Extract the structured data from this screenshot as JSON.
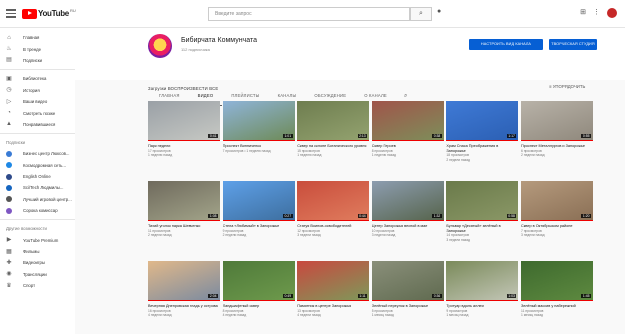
{
  "topbar": {
    "logo_text": "YouTube",
    "logo_region": "RU",
    "search_placeholder": "Введите запрос",
    "search_icon": "search-icon",
    "mic_icon": "microphone-icon"
  },
  "sidebar": {
    "main": [
      "Главная",
      "В тренде",
      "Подписки"
    ],
    "library": [
      "Библиотека",
      "История",
      "Ваши видео",
      "Смотреть позже",
      "Понравившиеся"
    ],
    "subs_heading": "Подписки",
    "subs": [
      "Бизнес центр Люксов...",
      "Космодромная сеть...",
      "English Online",
      "Sci/Tech Людмилы...",
      "Лучший игровой центр...",
      "Сорока комиссар"
    ],
    "more_heading": "Другие возможности",
    "more": [
      "YouTube Premium",
      "Фильмы",
      "Видеоигры",
      "Трансляции",
      "Спорт"
    ]
  },
  "channel": {
    "name": "Бибирчата Коммунчата",
    "subscribers": "112 подписчика",
    "customize_button": "НАСТРОИТЬ ВИД КАНАЛА",
    "manage_button": "ТВОРЧЕСКАЯ СТУДИЯ",
    "tabs": [
      "ГЛАВНАЯ",
      "ВИДЕО",
      "ПЛЕЙЛИСТЫ",
      "КАНАЛЫ",
      "ОБСУЖДЕНИЕ",
      "О КАНАЛЕ"
    ],
    "active_tab": "ВИДЕО"
  },
  "uploads": {
    "title": "Загрузки   ВОСПРОИЗВЕСТИ ВСЕ",
    "sort_label": "УПОРЯДОЧИТЬ",
    "videos": [
      {
        "title": "Парк недели",
        "views": "17 просмотров",
        "age": "1 неделю назад",
        "duration": "0:41",
        "c1": "#9aa0a6",
        "c2": "#c7c9c4"
      },
      {
        "title": "Проспект Винниченко",
        "views": "7 просмотров • 1 неделю назад",
        "age": "",
        "duration": "1:01",
        "c1": "#8fb4d9",
        "c2": "#6d8a55"
      },
      {
        "title": "Сквер на склоне Ботанического уровня",
        "views": "15 просмотров",
        "age": "1 неделю назад",
        "duration": "2:13",
        "c1": "#6e7d4f",
        "c2": "#94a370"
      },
      {
        "title": "Сквер Героев",
        "views": "8 просмотров",
        "age": "1 неделю назад",
        "duration": "0:38",
        "c1": "#a0544a",
        "c2": "#7d8f5a"
      },
      {
        "title": "Храм Спаса Преображения в Запорожье",
        "views": "18 просмотров",
        "age": "2 недели назад",
        "duration": "1:17",
        "c1": "#3f7ad6",
        "c2": "#2b5fb3"
      },
      {
        "title": "Проспект Металлургов и Запорожье",
        "views": "6 просмотров",
        "age": "2 недели назад",
        "duration": "0:55",
        "c1": "#b8b2a8",
        "c2": "#8f887c"
      },
      {
        "title": "Тихий уголок парка Шевченко",
        "views": "11 просмотров",
        "age": "2 недели назад",
        "duration": "1:08",
        "c1": "#6f6a5d",
        "c2": "#a3a58a"
      },
      {
        "title": "Стела «Любимый» в Запорожье",
        "views": "9 просмотров",
        "age": "2 недели назад",
        "duration": "0:27",
        "c1": "#5ea0e8",
        "c2": "#3d6e9e"
      },
      {
        "title": "Статуя Воинов-освободителей",
        "views": "12 просмотров",
        "age": "3 недели назад",
        "duration": "0:44",
        "c1": "#c94d3c",
        "c2": "#e07d5e"
      },
      {
        "title": "Центр Запорожья весной в мае",
        "views": "10 просмотров",
        "age": "3 недели назад",
        "duration": "1:32",
        "c1": "#8d9db0",
        "c2": "#55634a"
      },
      {
        "title": "Бульвар «Десятый» зелёный в Запорожье",
        "views": "14 просмотров",
        "age": "3 недели назад",
        "duration": "0:58",
        "c1": "#6a7a4a",
        "c2": "#8b9867"
      },
      {
        "title": "Сквер в Октябрьском районе",
        "views": "7 просмотров",
        "age": "3 недели назад",
        "duration": "1:20",
        "c1": "#b59a7d",
        "c2": "#8a6f55"
      },
      {
        "title": "Вечерняя Днепровская гладь у острова",
        "views": "16 просмотров",
        "age": "4 недели назад",
        "duration": "2:04",
        "c1": "#e0b88a",
        "c2": "#7a8aa0"
      },
      {
        "title": "Ландшафтный сквер",
        "views": "8 просмотров",
        "age": "4 недели назад",
        "duration": "0:49",
        "c1": "#4f7a3a",
        "c2": "#6e9a4c"
      },
      {
        "title": "Памятник в центре Запорожья",
        "views": "13 просмотров",
        "age": "4 недели назад",
        "duration": "1:11",
        "c1": "#c9483f",
        "c2": "#7d9a5a"
      },
      {
        "title": "Зелёный переулок в Запорожье",
        "views": "5 просмотров",
        "age": "1 месяц назад",
        "duration": "0:36",
        "c1": "#8a8f7a",
        "c2": "#5f6a4f"
      },
      {
        "title": "Тротуар вдоль аллеи",
        "views": "9 просмотров",
        "age": "1 месяц назад",
        "duration": "1:03",
        "c1": "#7a8a5a",
        "c2": "#c4c7b8"
      },
      {
        "title": "Зелёный массив у набережной",
        "views": "11 просмотров",
        "age": "1 месяц назад",
        "duration": "1:45",
        "c1": "#3e6a2e",
        "c2": "#5e8a40"
      }
    ]
  }
}
